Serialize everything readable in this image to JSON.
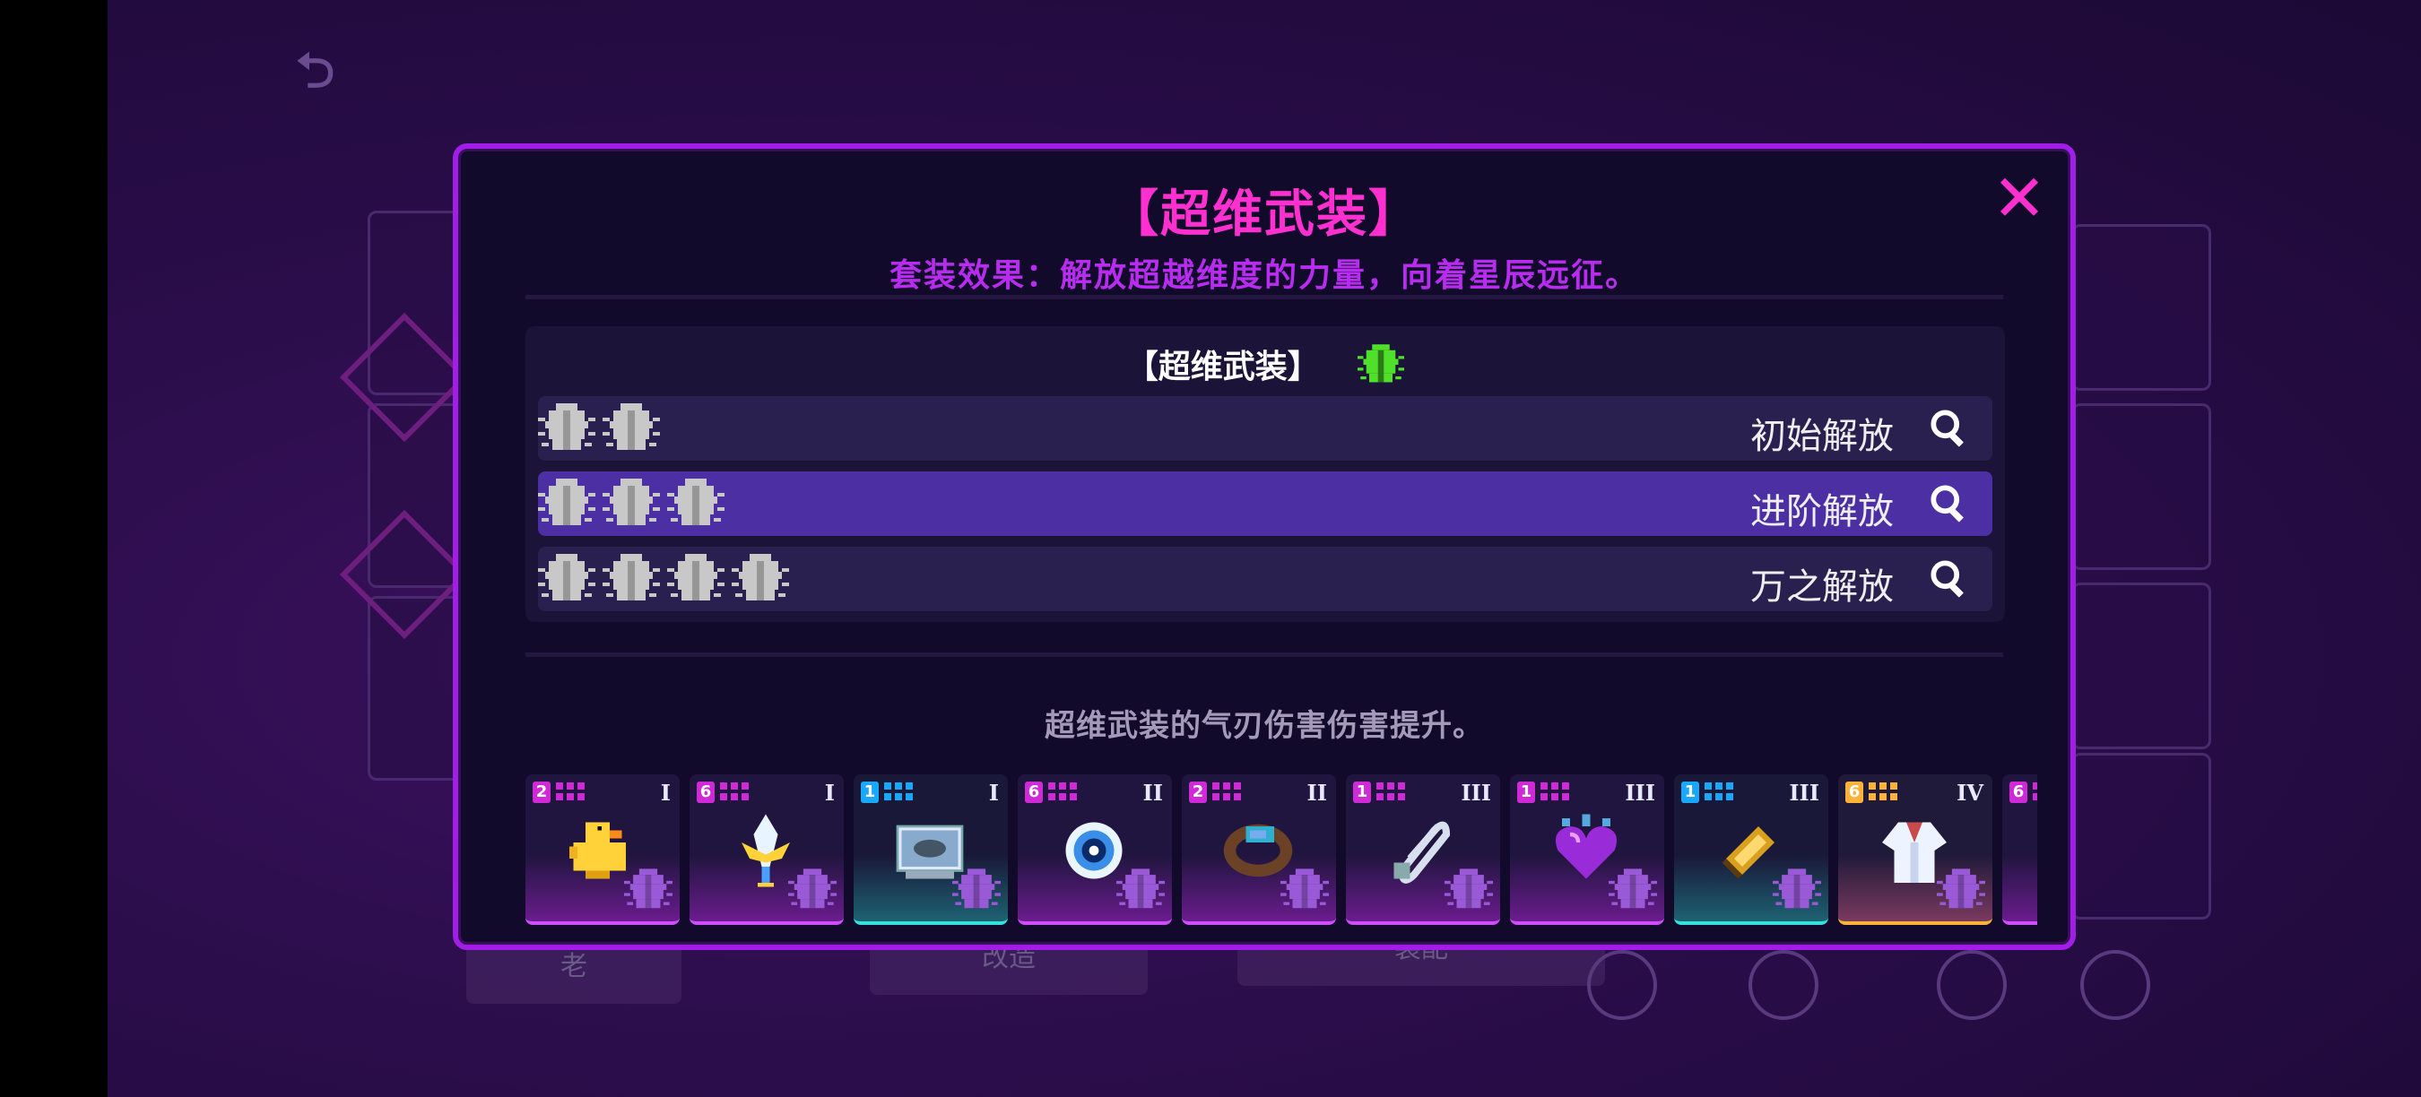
{
  "dialog": {
    "title": "【超维武装】",
    "close_icon": "close-icon",
    "set_effect": "套装效果：解放超越维度的力量，向着星辰远征。",
    "set_header": "【超维武装】",
    "tiers": [
      {
        "label": "初始解放",
        "count": 2,
        "active": false
      },
      {
        "label": "进阶解放",
        "count": 3,
        "active": true
      },
      {
        "label": "万之解放",
        "count": 4,
        "active": false
      }
    ],
    "description": "超维武装的气刃伤害伤害提升。",
    "items": [
      {
        "name": "duck",
        "badge": "2",
        "badge_color": "#d02ad8",
        "tier": "I",
        "style": "purple",
        "icon": "duck-icon"
      },
      {
        "name": "sword",
        "badge": "6",
        "badge_color": "#d02ad8",
        "tier": "I",
        "style": "purple",
        "icon": "sword-icon"
      },
      {
        "name": "fish-tank",
        "badge": "1",
        "badge_color": "#1aa8ff",
        "tier": "I",
        "style": "teal",
        "icon": "fish-tank-icon"
      },
      {
        "name": "eye-orb",
        "badge": "6",
        "badge_color": "#d02ad8",
        "tier": "II",
        "style": "purple",
        "icon": "eye-orb-icon"
      },
      {
        "name": "bracelet",
        "badge": "2",
        "badge_color": "#d02ad8",
        "tier": "II",
        "style": "purple",
        "icon": "bracelet-icon"
      },
      {
        "name": "safety-pin",
        "badge": "1",
        "badge_color": "#d02ad8",
        "tier": "III",
        "style": "purple",
        "icon": "safety-pin-icon"
      },
      {
        "name": "heart",
        "badge": "1",
        "badge_color": "#d02ad8",
        "tier": "III",
        "style": "purple",
        "icon": "heart-icon"
      },
      {
        "name": "gold-bar",
        "badge": "1",
        "badge_color": "#1aa8ff",
        "tier": "III",
        "style": "teal",
        "icon": "gold-bar-icon"
      },
      {
        "name": "uniform",
        "badge": "6",
        "badge_color": "#ffb23a",
        "tier": "IV",
        "style": "gold",
        "icon": "uniform-icon"
      },
      {
        "name": "partial",
        "badge": "6",
        "badge_color": "#d02ad8",
        "tier": "",
        "style": "purple",
        "icon": "item-icon"
      }
    ]
  },
  "background": {
    "back_icon": "back-icon",
    "bottom_labels": [
      "老",
      "改造",
      "装配"
    ]
  },
  "colors": {
    "accent": "#ff2fd0",
    "frame": "#a21ee8",
    "set_green": "#4fe02a"
  }
}
